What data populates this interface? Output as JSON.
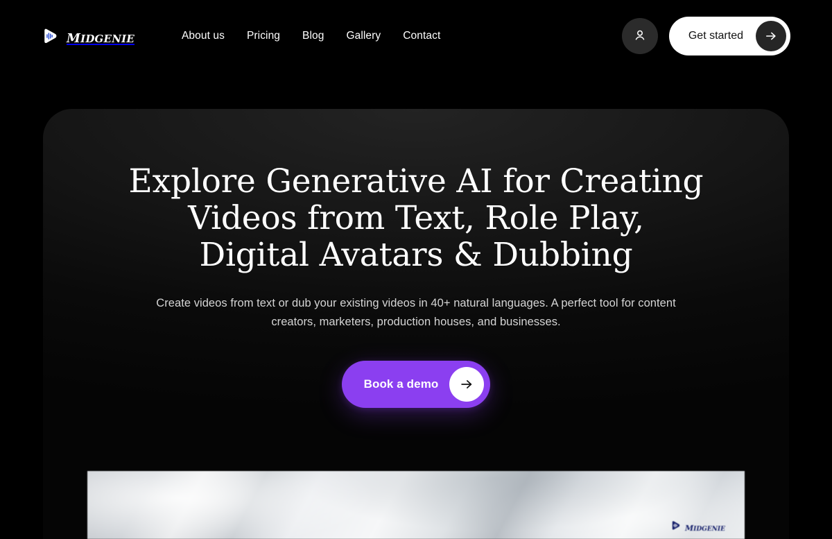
{
  "brand": {
    "name": "MidGenie",
    "icon": "play-waveform-icon"
  },
  "nav": {
    "links": [
      {
        "label": "About us"
      },
      {
        "label": "Pricing"
      },
      {
        "label": "Blog"
      },
      {
        "label": "Gallery"
      },
      {
        "label": "Contact"
      }
    ],
    "account_icon": "user-account-icon",
    "cta": {
      "label": "Get started",
      "arrow_icon": "arrow-right-icon"
    }
  },
  "hero": {
    "title": "Explore Generative AI for Creating Videos from Text, Role Play, Digital Avatars & Dubbing",
    "subtitle": "Create videos from text or dub your existing videos in 40+ natural languages. A perfect tool for content creators, marketers, production houses, and businesses.",
    "demo_button": {
      "label": "Book a demo",
      "arrow_icon": "arrow-right-icon"
    }
  },
  "video_preview": {
    "watermark_name": "MidGenie",
    "watermark_icon": "play-waveform-icon"
  },
  "colors": {
    "page_background": "#000000",
    "card_background": "#151515",
    "accent_purple": "#8b3ff0",
    "cta_white": "#ffffff",
    "avatar_gray": "#2b2b2b",
    "watermark_navy": "#16206b"
  }
}
